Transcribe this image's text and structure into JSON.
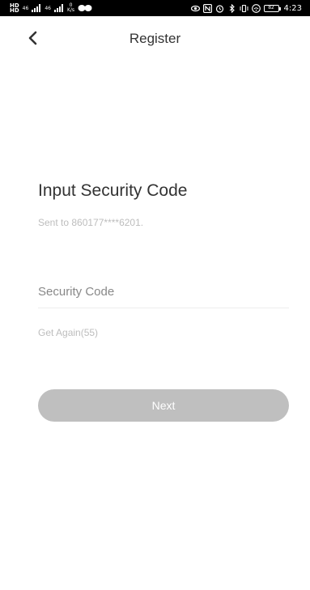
{
  "status_bar": {
    "sim_labels": [
      "HD",
      "HD"
    ],
    "signal_1": "46",
    "signal_2": "46",
    "net_speed_value": "0",
    "net_speed_unit": "K/s",
    "battery": "82",
    "time": "4:23",
    "icons": [
      "eye-icon",
      "nfc-icon",
      "alarm-icon",
      "bluetooth-icon",
      "vibrate-icon",
      "wifi-icon"
    ]
  },
  "header": {
    "title": "Register",
    "back_icon": "chevron-left-icon"
  },
  "main": {
    "title": "Input Security Code",
    "sent_to": "Sent to 860177****6201.",
    "code_placeholder": "Security Code",
    "code_value": "",
    "get_again": "Get Again(55)",
    "next_label": "Next"
  },
  "colors": {
    "title_text": "#333333",
    "muted_text": "#bdbdbd",
    "button_disabled": "#bfbfbf",
    "divider": "#eeeeee"
  }
}
